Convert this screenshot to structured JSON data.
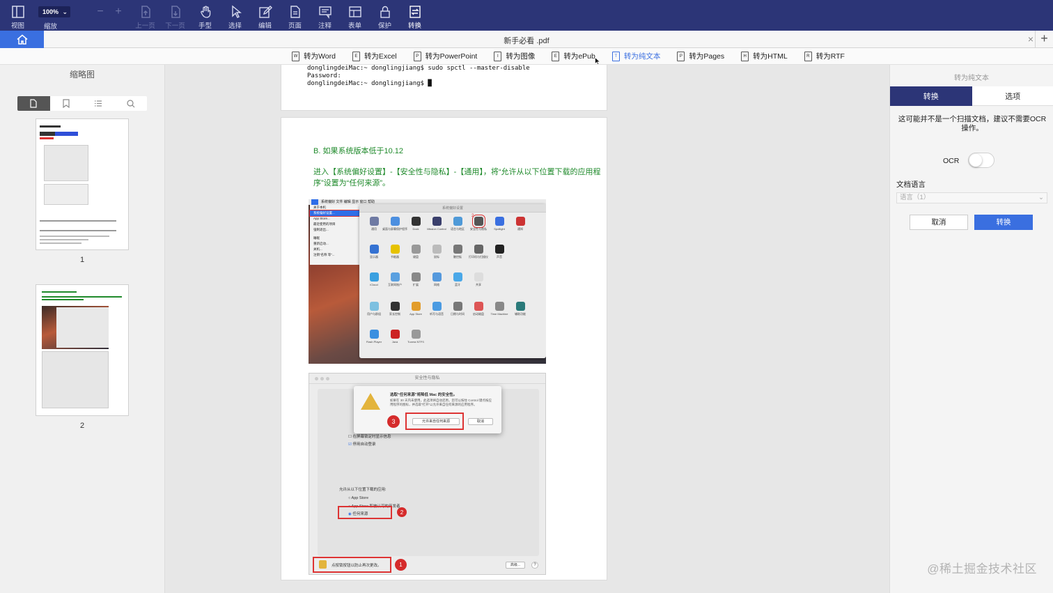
{
  "toolbar": {
    "view": "视图",
    "zoom_value": "100%",
    "zoom_label": "缩放",
    "prev_page": "上一页",
    "next_page": "下一页",
    "hand": "手型",
    "select": "选择",
    "edit": "编辑",
    "page": "页面",
    "annotate": "注释",
    "form": "表单",
    "protect": "保护",
    "convert": "转换"
  },
  "tabbar": {
    "document_title": "新手必看 .pdf",
    "close_glyph": "×",
    "add_glyph": "+"
  },
  "convert_bar": {
    "items": [
      {
        "label": "转为Word",
        "badge": "W"
      },
      {
        "label": "转为Excel",
        "badge": "E"
      },
      {
        "label": "转为PowerPoint",
        "badge": "P"
      },
      {
        "label": "转为图像",
        "badge": "I"
      },
      {
        "label": "转为ePub",
        "badge": "E"
      },
      {
        "label": "转为纯文本",
        "badge": "T",
        "active": true
      },
      {
        "label": "转为Pages",
        "badge": "P"
      },
      {
        "label": "转为HTML",
        "badge": "H"
      },
      {
        "label": "转为RTF",
        "badge": "R"
      }
    ]
  },
  "thumbnails": {
    "title": "缩略图",
    "pages": [
      {
        "number": "1"
      },
      {
        "number": "2"
      }
    ]
  },
  "document": {
    "terminal_lines": [
      "donglingdeiMac:~ donglingjiang$ sudo spctl --master-disable",
      "Password:",
      "donglingdeiMac:~ donglingjiang$ █"
    ],
    "heading": "B. 如果系统版本低于10.12",
    "paragraph": "进入【系统偏好设置】-【安全性与隐私】-【通用】，将“允许从以下位置下载的应用程序”设置为“任何来源”。",
    "shot1": {
      "menubar": "  系统偏好  文件  编辑  显示  窗口  帮助",
      "apple_menu": [
        "关于本机",
        "系统偏好设置...",
        "App Store...",
        "最近使用的项目",
        "强制退出...",
        "睡眠",
        "重新启动...",
        "关机...",
        "注销“名称 等”..."
      ],
      "window_title": "系统偏好设置",
      "marker": "2",
      "row1": [
        "通用",
        "桌面与屏幕保护程序",
        "Dock",
        "Mission Control",
        "语言与地区",
        "安全性与隐私",
        "Spotlight",
        "通知"
      ],
      "row2": [
        "显示器",
        "节能器",
        "键盘",
        "鼠标",
        "触控板",
        "打印机与扫描仪",
        "声音"
      ],
      "row3": [
        "iCloud",
        "互联网账户",
        "扩展",
        "网络",
        "蓝牙",
        "共享"
      ],
      "row4": [
        "用户与群组",
        "家长控制",
        "App Store",
        "听写与语音",
        "日期与时间",
        "启动磁盘",
        "Time Machine",
        "辅助功能"
      ],
      "row5": [
        "Flash Player",
        "Java",
        "Tuxera NTFS"
      ]
    },
    "shot2": {
      "window_title": "安全性与隐私",
      "dialog_title": "选取“任何来源”将降低 Mac 的安全性。",
      "dialog_text": "如果在 30 天内未使用，此选项将自动还原。您可以按住 Control 键点按应用程序的图标，并选取“打开”以允许来自任何来源的应用程序。",
      "allow_button": "允许来自任何来源",
      "cancel_button": "取消",
      "lock_settings": "在屏幕锁定时显示信息",
      "auto_login": "停用自动登录",
      "allow_apps_title": "允许从以下位置下载的应用:",
      "option_app_store": "App Store",
      "option_identified": "App Store 和被认可的开发者",
      "option_anywhere": "任何来源",
      "lock_text": "点按锁按钮以防止再次更改。",
      "advanced_button": "高级...",
      "help_glyph": "?",
      "markers": [
        "1",
        "2",
        "3"
      ]
    }
  },
  "right_panel": {
    "title": "转为纯文本",
    "tab_convert": "转换",
    "tab_options": "选项",
    "note": "这可能并不是一个扫描文档，建议不需要OCR操作。",
    "ocr_label": "OCR",
    "ocr_enabled": false,
    "language_label": "文档语言",
    "language_value": "语言（1）",
    "cancel_button": "取消",
    "convert_button": "转换"
  },
  "credit": "@稀土掘金技术社区",
  "colors": {
    "toolbar_bg": "#2c3577",
    "accent": "#3a6fe0",
    "heading_green": "#1f8a2b",
    "marker_red": "#d52b2b"
  }
}
